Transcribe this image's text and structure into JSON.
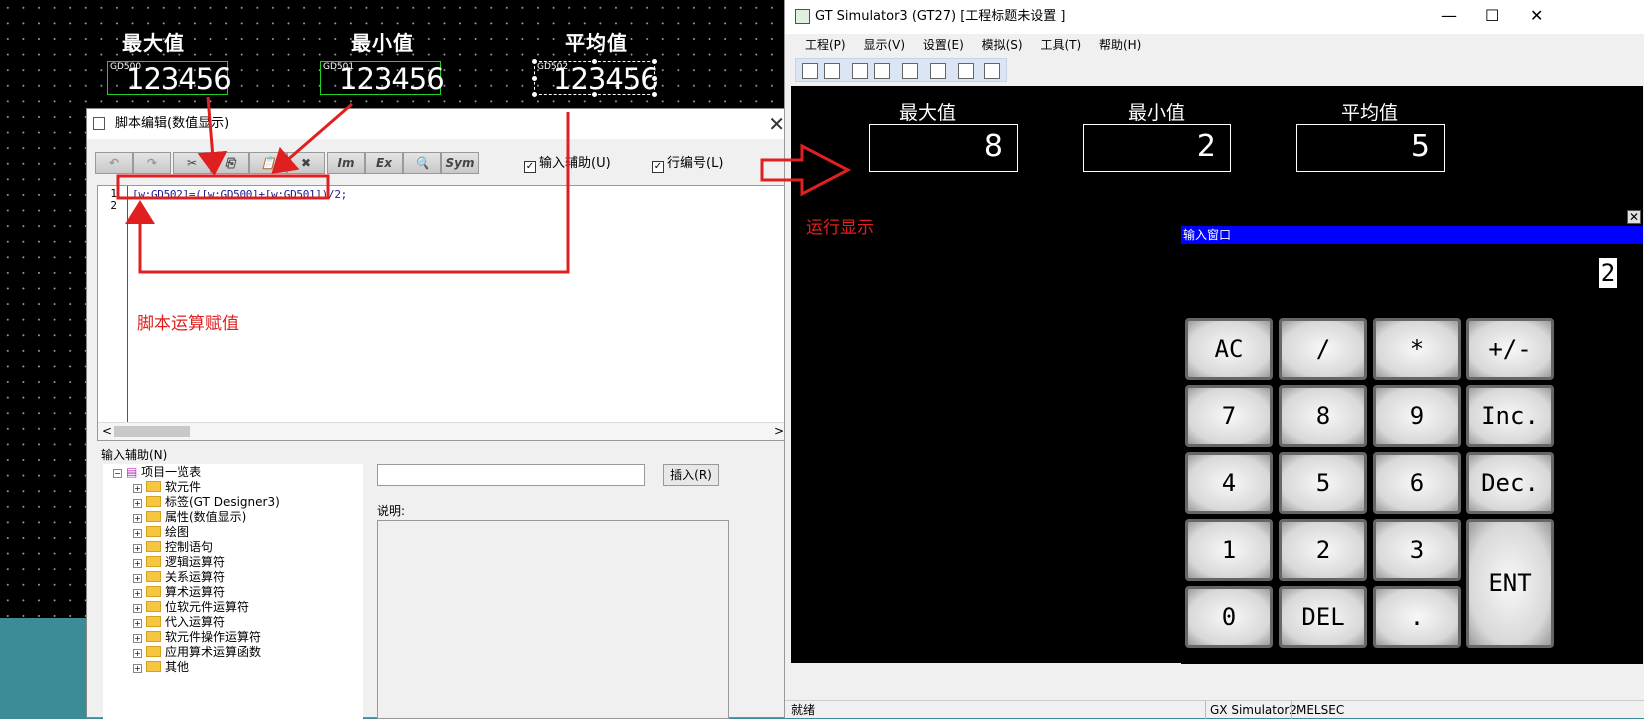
{
  "design": {
    "headers": [
      "最大值",
      "最小值",
      "平均值"
    ],
    "displays": [
      {
        "device": "GD500",
        "value": "123456"
      },
      {
        "device": "GD501",
        "value": "123456"
      },
      {
        "device": "GD502",
        "value": "123456"
      }
    ]
  },
  "script_dialog": {
    "title": "脚本编辑(数值显示)",
    "close": "✕",
    "toolbar": [
      "↶",
      "↷",
      "✂",
      "⎘",
      "📋",
      "✖",
      "Im",
      "Ex",
      "🔍",
      "Sym"
    ],
    "input_assist_label": "输入辅助(U)",
    "line_number_label": "行编号(L)",
    "line_numbers": [
      "1",
      "2"
    ],
    "code_line_1": "[w:GD502]=([w:GD500]+[w:GD501])/2;",
    "section_label": "输入辅助(N)",
    "tree_root": "项目一览表",
    "tree_items": [
      "软元件",
      "标签(GT Designer3)",
      "属性(数值显示)",
      "绘图",
      "控制语句",
      "逻辑运算符",
      "关系运算符",
      "算术运算符",
      "位软元件运算符",
      "代入运算符",
      "软元件操作运算符",
      "应用算术运算函数",
      "其他"
    ],
    "insert_button": "插入(R)",
    "description_label": "说明:",
    "scroll_left": "<",
    "scroll_right": ">"
  },
  "annotations": {
    "script_note": "脚本运算赋值",
    "run_note": "运行显示"
  },
  "simulator": {
    "title": "GT Simulator3 (GT27)  [工程标题未设置 ]",
    "menu": [
      "工程(P)",
      "显示(V)",
      "设置(E)",
      "模拟(S)",
      "工具(T)",
      "帮助(H)"
    ],
    "window_buttons": [
      "—",
      "☐",
      "✕"
    ],
    "headers": [
      "最大值",
      "最小值",
      "平均值"
    ],
    "values": [
      "8",
      "2",
      "5"
    ],
    "keypad": {
      "title": "输入窗口",
      "display": "2",
      "close": "✕",
      "keys": [
        "AC",
        "/",
        "*",
        "+/-",
        "7",
        "8",
        "9",
        "Inc.",
        "4",
        "5",
        "6",
        "Dec.",
        "1",
        "2",
        "3",
        "ENT",
        "0",
        "DEL",
        "."
      ]
    },
    "status_left": "就绪",
    "status_mid": "GX Simulator2",
    "status_right": "MELSEC"
  },
  "colors": {
    "annotation": "#e02020",
    "keypad_titlebar": "#0000ff",
    "display_border": "#1fd21f"
  }
}
